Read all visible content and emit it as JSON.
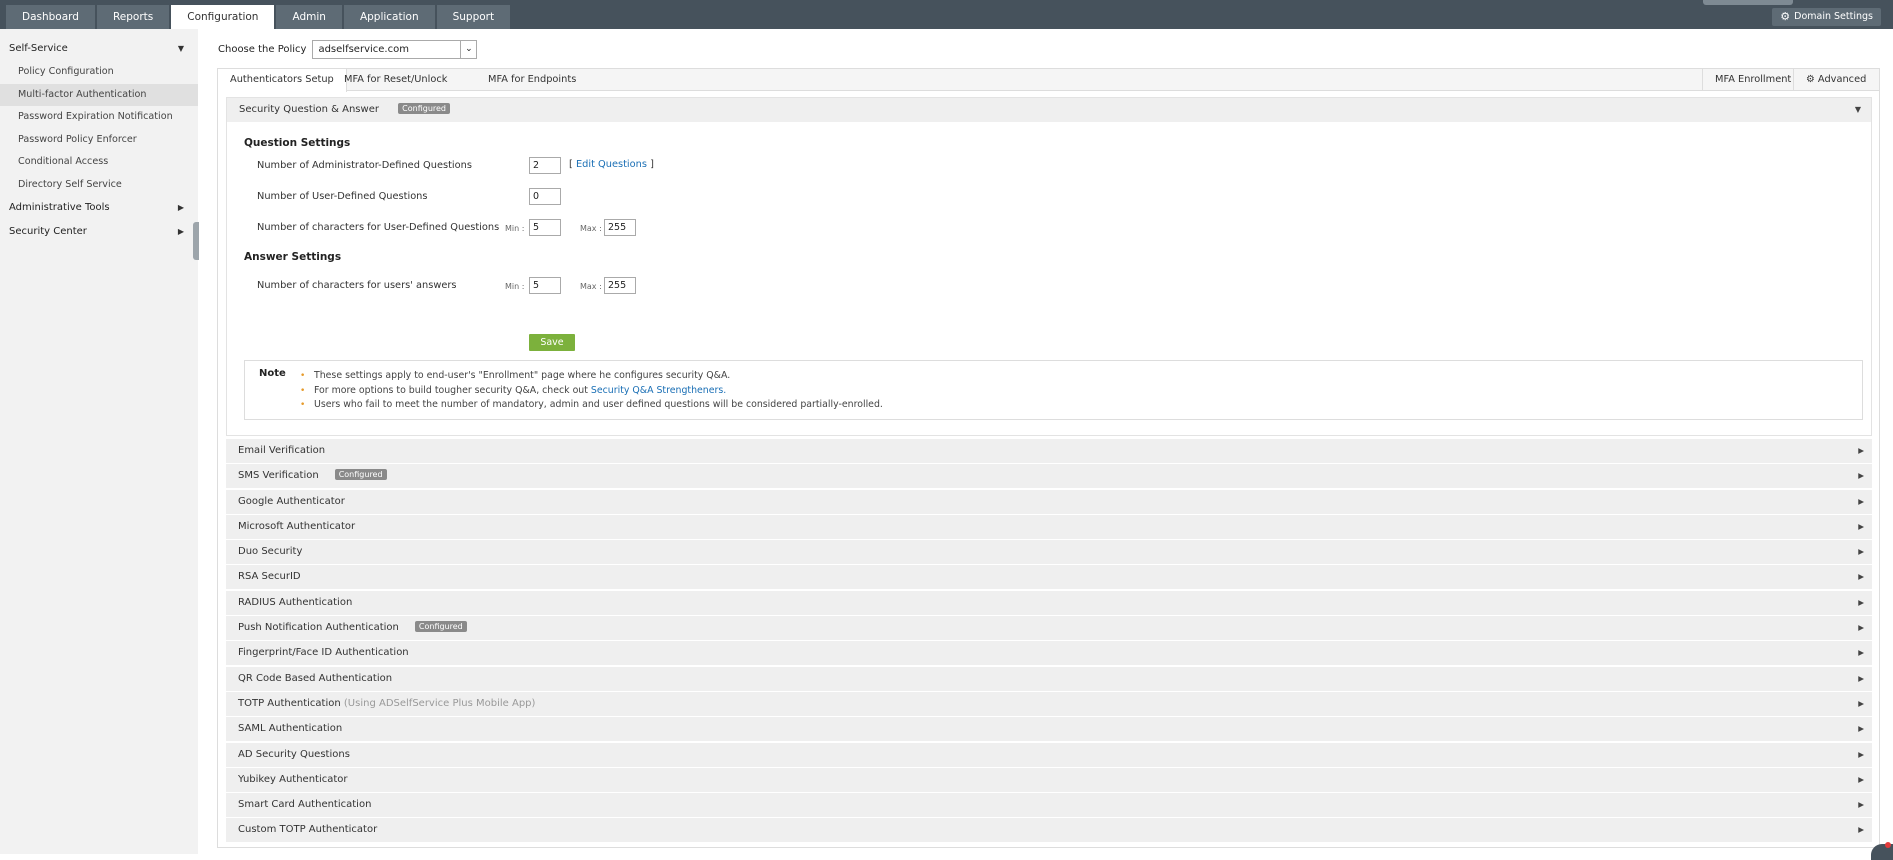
{
  "topnav": {
    "tabs": [
      "Dashboard",
      "Reports",
      "Configuration",
      "Admin",
      "Application",
      "Support"
    ],
    "active_tab": "Configuration",
    "domain_settings": "Domain Settings"
  },
  "sidebar": {
    "self_service": "Self-Service",
    "items": [
      "Policy Configuration",
      "Multi-factor Authentication",
      "Password Expiration Notification",
      "Password Policy Enforcer",
      "Conditional Access",
      "Directory Self Service"
    ],
    "active_item": "Multi-factor Authentication",
    "administrative_tools": "Administrative Tools",
    "security_center": "Security Center"
  },
  "policy": {
    "label": "Choose the Policy",
    "value": "adselfservice.com"
  },
  "subtabs": {
    "authenticators_setup": "Authenticators Setup",
    "mfa_reset_unlock": "MFA for Reset/Unlock",
    "mfa_endpoints": "MFA for Endpoints",
    "mfa_enrollment": "MFA Enrollment",
    "advanced": "Advanced"
  },
  "security_qa": {
    "title": "Security Question & Answer",
    "badge": "Configured",
    "question_settings": "Question Settings",
    "admin_questions_label": "Number of Administrator-Defined Questions",
    "admin_questions_value": "2",
    "edit_open": "[",
    "edit_link": "Edit Questions",
    "edit_close": "]",
    "user_questions_label": "Number of User-Defined Questions",
    "user_questions_value": "0",
    "user_chars_label": "Number of characters for User-Defined Questions",
    "min_label": "Min :",
    "max_label": "Max :",
    "user_chars_min": "5",
    "user_chars_max": "255",
    "answer_settings": "Answer Settings",
    "answer_chars_label": "Number of characters for users' answers",
    "answer_chars_min": "5",
    "answer_chars_max": "255",
    "save": "Save"
  },
  "note": {
    "title": "Note",
    "line1": "These settings apply to end-user's \"Enrollment\" page where he configures security Q&A.",
    "line2_prefix": "For more options to build tougher security Q&A, check out",
    "line2_link": "Security Q&A Strengtheners.",
    "line3": "Users who fail to meet the number of mandatory, admin and user defined questions will be considered partially-enrolled."
  },
  "authenticators": {
    "email": "Email Verification",
    "sms": "SMS Verification",
    "sms_badge": "Configured",
    "google": "Google Authenticator",
    "microsoft": "Microsoft Authenticator",
    "duo": "Duo Security",
    "rsa": "RSA SecurID",
    "radius": "RADIUS Authentication",
    "push": "Push Notification Authentication",
    "push_badge": "Configured",
    "fingerprint": "Fingerprint/Face ID Authentication",
    "qr": "QR Code Based Authentication",
    "totp": "TOTP Authentication",
    "totp_suffix": "(Using ADSelfService Plus Mobile App)",
    "saml": "SAML Authentication",
    "ad_questions": "AD Security Questions",
    "yubikey": "Yubikey Authenticator",
    "smart_card": "Smart Card Authentication",
    "custom_totp": "Custom TOTP Authenticator"
  },
  "colors": {
    "topbar": "#46525c",
    "save_button": "#7cb13c",
    "link": "#1a6fb5",
    "bullet": "#e69a2a"
  }
}
